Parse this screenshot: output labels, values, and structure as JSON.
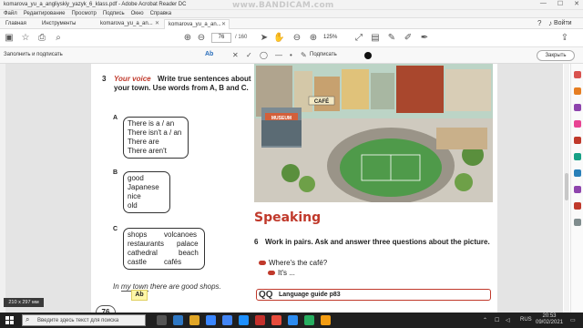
{
  "window": {
    "title": "komarova_yu_a_angliyskiy_yazyk_6_klass.pdf - Adobe Acrobat Reader DC",
    "watermark": "www.BANDICAM.com",
    "controls": [
      "—",
      "☐",
      "✕"
    ]
  },
  "menu": [
    "Файл",
    "Редактирование",
    "Просмотр",
    "Подпись",
    "Окно",
    "Справка"
  ],
  "tabs": [
    {
      "label": "Главная"
    },
    {
      "label": "Инструменты"
    },
    {
      "label": "komarova_yu_a_an..."
    },
    {
      "label": "komarova_yu_a_an..."
    }
  ],
  "header_right": {
    "help": "?",
    "login": "Войти"
  },
  "toolbar": {
    "page_current": "76",
    "page_total": "/ 160",
    "zoom": "125%"
  },
  "fill_sign": {
    "label": "Заполнить и подписать",
    "tool_text": "Ab",
    "sign_label": "Подписать",
    "close_label": "Закрыть"
  },
  "page": {
    "ex3": {
      "number": "3",
      "your_voice": "Your voice",
      "instruction": "Write true sentences about your town. Use words from A, B and C."
    },
    "box_a": {
      "label": "A",
      "items": [
        "There is a / an",
        "There isn't a / an",
        "There are",
        "There aren't"
      ]
    },
    "box_b": {
      "label": "B",
      "items": [
        "good",
        "Japanese",
        "nice",
        "old"
      ]
    },
    "box_c": {
      "label": "C",
      "pairs": [
        [
          "shops",
          "volcanoes"
        ],
        [
          "restaurants",
          "palace"
        ],
        [
          "cathedral",
          "beach"
        ],
        [
          "castle",
          "cafés"
        ]
      ]
    },
    "example": {
      "prefix": "In ",
      "underlined": "my town",
      "suffix": " there are good shops."
    },
    "cursor_tag": "Ab",
    "page_number": "76",
    "illustration_signs": {
      "sign1": "CAFÉ",
      "sign2": "MUSEUM"
    },
    "speaking": {
      "heading": "Speaking",
      "ex6_number": "6",
      "ex6_text": "Work in pairs. Ask and answer three questions about the picture.",
      "line1": "Where's the café?",
      "line2": "It's ..."
    },
    "guide": {
      "logo": "QQ",
      "text": "Language guide p83"
    }
  },
  "size_badge": "210 x 297 мм",
  "taskbar": {
    "search_placeholder": "Введите здесь текст для поиска",
    "lang": "RUS",
    "time": "20:53",
    "date": "09/02/2021"
  },
  "colors": {
    "accent_red": "#c0392b",
    "taskbar": "#202020"
  }
}
